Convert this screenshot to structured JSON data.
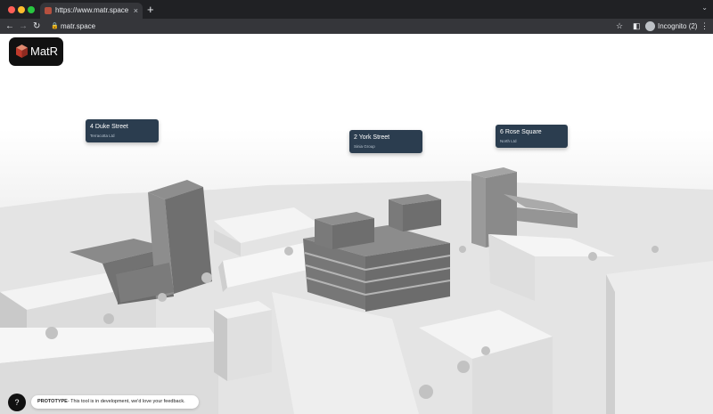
{
  "browser": {
    "tab_title": "https://www.matr.space",
    "tab_close": "×",
    "new_tab": "+",
    "tab_menu": "⌄",
    "back": "←",
    "forward": "→",
    "reload": "↻",
    "lock_icon": "🔒",
    "address": "matr.space",
    "bookmark_icon": "☆",
    "sidepanel_icon": "◧",
    "profile_label": "Incognito (2)",
    "menu_icon": "⋮"
  },
  "app": {
    "logo_text": "MatR",
    "labels": [
      {
        "title": "4 Duke Street",
        "subtitle": "Terracotta Ltd"
      },
      {
        "title": "2 York Street",
        "subtitle": "Sinia Group"
      },
      {
        "title": "6 Rose Square",
        "subtitle": "North Ltd"
      }
    ],
    "help_label": "?",
    "prototype_bold": "PROTOTYPE",
    "prototype_text": "- This tool is in development, we'd love your feedback."
  },
  "colors": {
    "label_bg": "#2b3d4f",
    "logo_bg": "#111111",
    "highlight_building": "#7a7a7a"
  }
}
